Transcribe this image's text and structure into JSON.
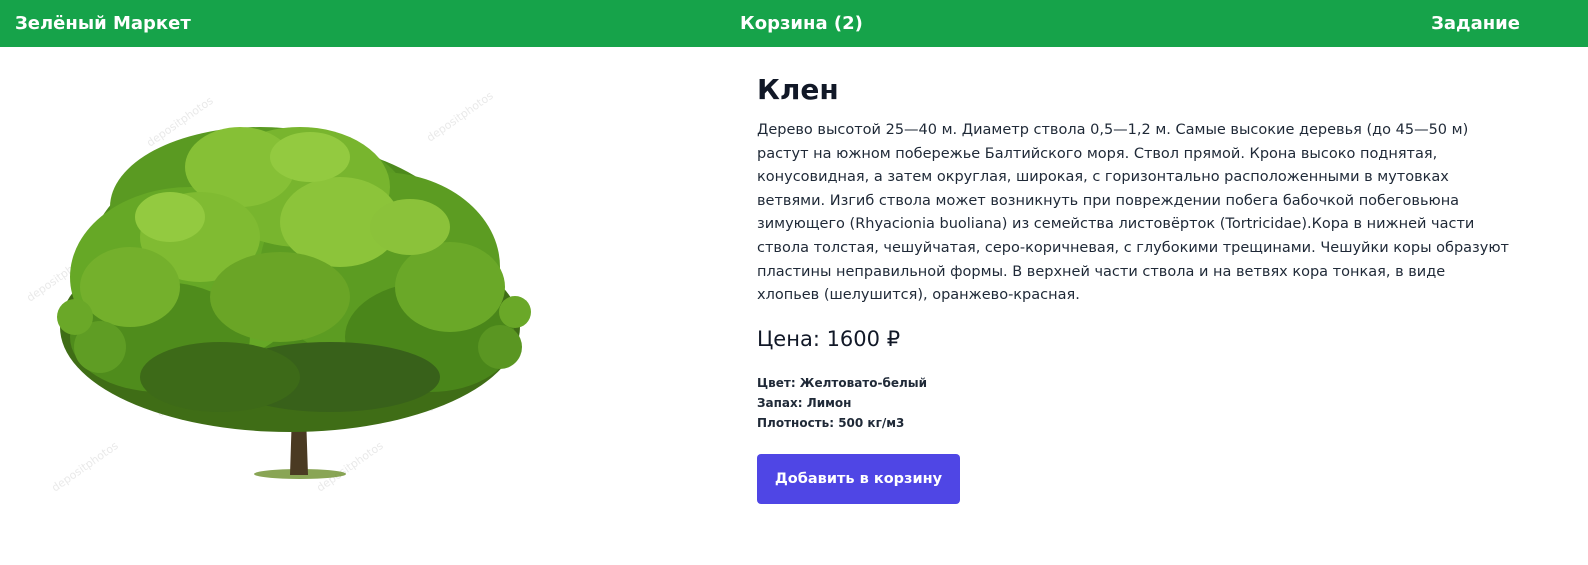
{
  "header": {
    "brand": "Зелёный Маркет",
    "cart_label": "Корзина (2)",
    "task_label": "Задание",
    "background_color": "#16a34a"
  },
  "product": {
    "image_icon": "tree-image",
    "watermark": "depositphotos",
    "title": "Клен",
    "description": "Дерево высотой 25—40 м. Диаметр ствола 0,5—1,2 м. Самые высокие деревья (до 45—50 м) растут на южном побережье Балтийского моря. Ствол прямой. Крона высоко поднятая, конусовидная, а затем округлая, широкая, с горизонтально расположенными в мутовках ветвями. Изгиб ствола может возникнуть при повреждении побега бабочкой побеговьюна зимующего (Rhyacionia buoliana) из семейства листовёрток (Tortricidae).Кора в нижней части ствола толстая, чешуйчатая, серо-коричневая, с глубокими трещинами. Чешуйки коры образуют пластины неправильной формы. В верхней части ствола и на ветвях кора тонкая, в виде хлопьев (шелушится), оранжево-красная.",
    "price_label": "Цена: 1600 ₽",
    "specs": [
      "Цвет: Желтовато-белый",
      "Запах: Лимон",
      "Плотность: 500 кг/м3"
    ],
    "add_to_cart_label": "Добавить в корзину",
    "button_color": "#4f46e5"
  }
}
